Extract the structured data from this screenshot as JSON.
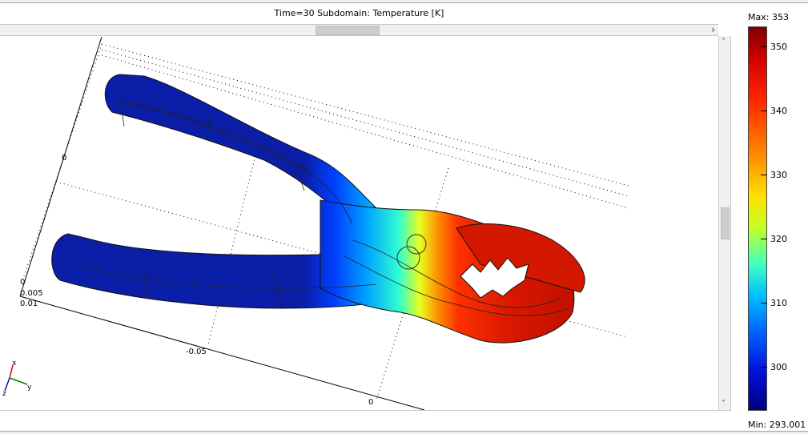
{
  "plot": {
    "title": "Time=30    Subdomain: Temperature [K]"
  },
  "axes": {
    "labels": {
      "y0": "0",
      "z0": "0",
      "z005": "0.005",
      "z01": "0.01",
      "xneg05": "-0.05",
      "x0": "0"
    },
    "triad": {
      "x": "x",
      "y": "y",
      "z": "z"
    }
  },
  "legend": {
    "max_label": "Max: 353",
    "min_label": "Min: 293.001",
    "ticks": [
      "350",
      "340",
      "330",
      "320",
      "310",
      "300"
    ],
    "colormap": "jet",
    "colors": {
      "hot": "#c81400",
      "cold": "#0a1e9c",
      "mid": "#30ffd0"
    }
  },
  "icons": {
    "scroll_right": "chevron-right-icon",
    "scroll_up": "chevron-up-icon",
    "scroll_down": "chevron-down-icon"
  }
}
